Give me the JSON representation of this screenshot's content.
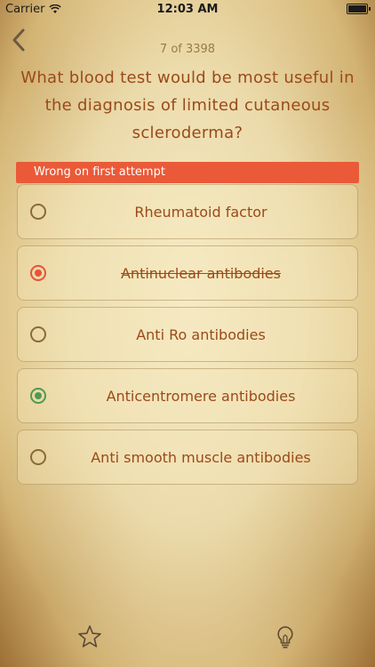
{
  "status_bar": {
    "carrier": "Carrier",
    "time": "12:03 AM"
  },
  "header": {
    "counter": "7 of 3398"
  },
  "question": "What blood test would be most useful in the diagnosis of limited cutaneous scleroderma?",
  "banner": "Wrong on first attempt",
  "options": [
    {
      "label": "Rheumatoid factor",
      "state": "none"
    },
    {
      "label": "Antinuclear antibodies",
      "state": "wrong"
    },
    {
      "label": "Anti Ro antibodies",
      "state": "none"
    },
    {
      "label": "Anticentromere antibodies",
      "state": "correct"
    },
    {
      "label": "Anti smooth muscle antibodies",
      "state": "none"
    }
  ],
  "toolbar": {
    "left_icon": "star-icon",
    "right_icon": "lightbulb-icon"
  },
  "colors": {
    "accent_text": "#9b4a1a",
    "wrong": "#e8533a",
    "correct": "#4c9a55",
    "banner": "#ea5a38"
  }
}
